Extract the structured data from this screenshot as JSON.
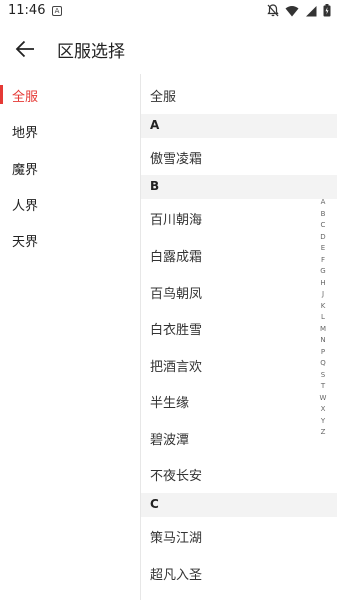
{
  "status_bar": {
    "time": "11:46",
    "notification_icon": "A",
    "icons": [
      "mute-bell-icon",
      "wifi-icon",
      "signal-icon",
      "battery-charging-icon"
    ]
  },
  "header": {
    "back_icon": "arrow-left-icon",
    "title": "区服选择"
  },
  "sidebar": {
    "accent_color": "#e53935",
    "items": [
      {
        "label": "全服",
        "active": true
      },
      {
        "label": "地界",
        "active": false
      },
      {
        "label": "魔界",
        "active": false
      },
      {
        "label": "人界",
        "active": false
      },
      {
        "label": "天界",
        "active": false
      }
    ]
  },
  "server_list": {
    "rows": [
      {
        "type": "item",
        "text": "全服"
      },
      {
        "type": "header",
        "text": "A"
      },
      {
        "type": "item",
        "text": "傲雪凌霜"
      },
      {
        "type": "header",
        "text": "B"
      },
      {
        "type": "item",
        "text": "百川朝海"
      },
      {
        "type": "item",
        "text": "白露成霜"
      },
      {
        "type": "item",
        "text": "百鸟朝凤"
      },
      {
        "type": "item",
        "text": "白衣胜雪"
      },
      {
        "type": "item",
        "text": "把酒言欢"
      },
      {
        "type": "item",
        "text": "半生缘"
      },
      {
        "type": "item",
        "text": "碧波潭"
      },
      {
        "type": "item",
        "text": "不夜长安"
      },
      {
        "type": "header",
        "text": "C"
      },
      {
        "type": "item",
        "text": "策马江湖"
      },
      {
        "type": "item",
        "text": "超凡入圣"
      }
    ]
  },
  "index_bar": {
    "letters": [
      "A",
      "B",
      "C",
      "D",
      "E",
      "F",
      "G",
      "H",
      "J",
      "K",
      "L",
      "M",
      "N",
      "P",
      "Q",
      "S",
      "T",
      "W",
      "X",
      "Y",
      "Z"
    ]
  }
}
